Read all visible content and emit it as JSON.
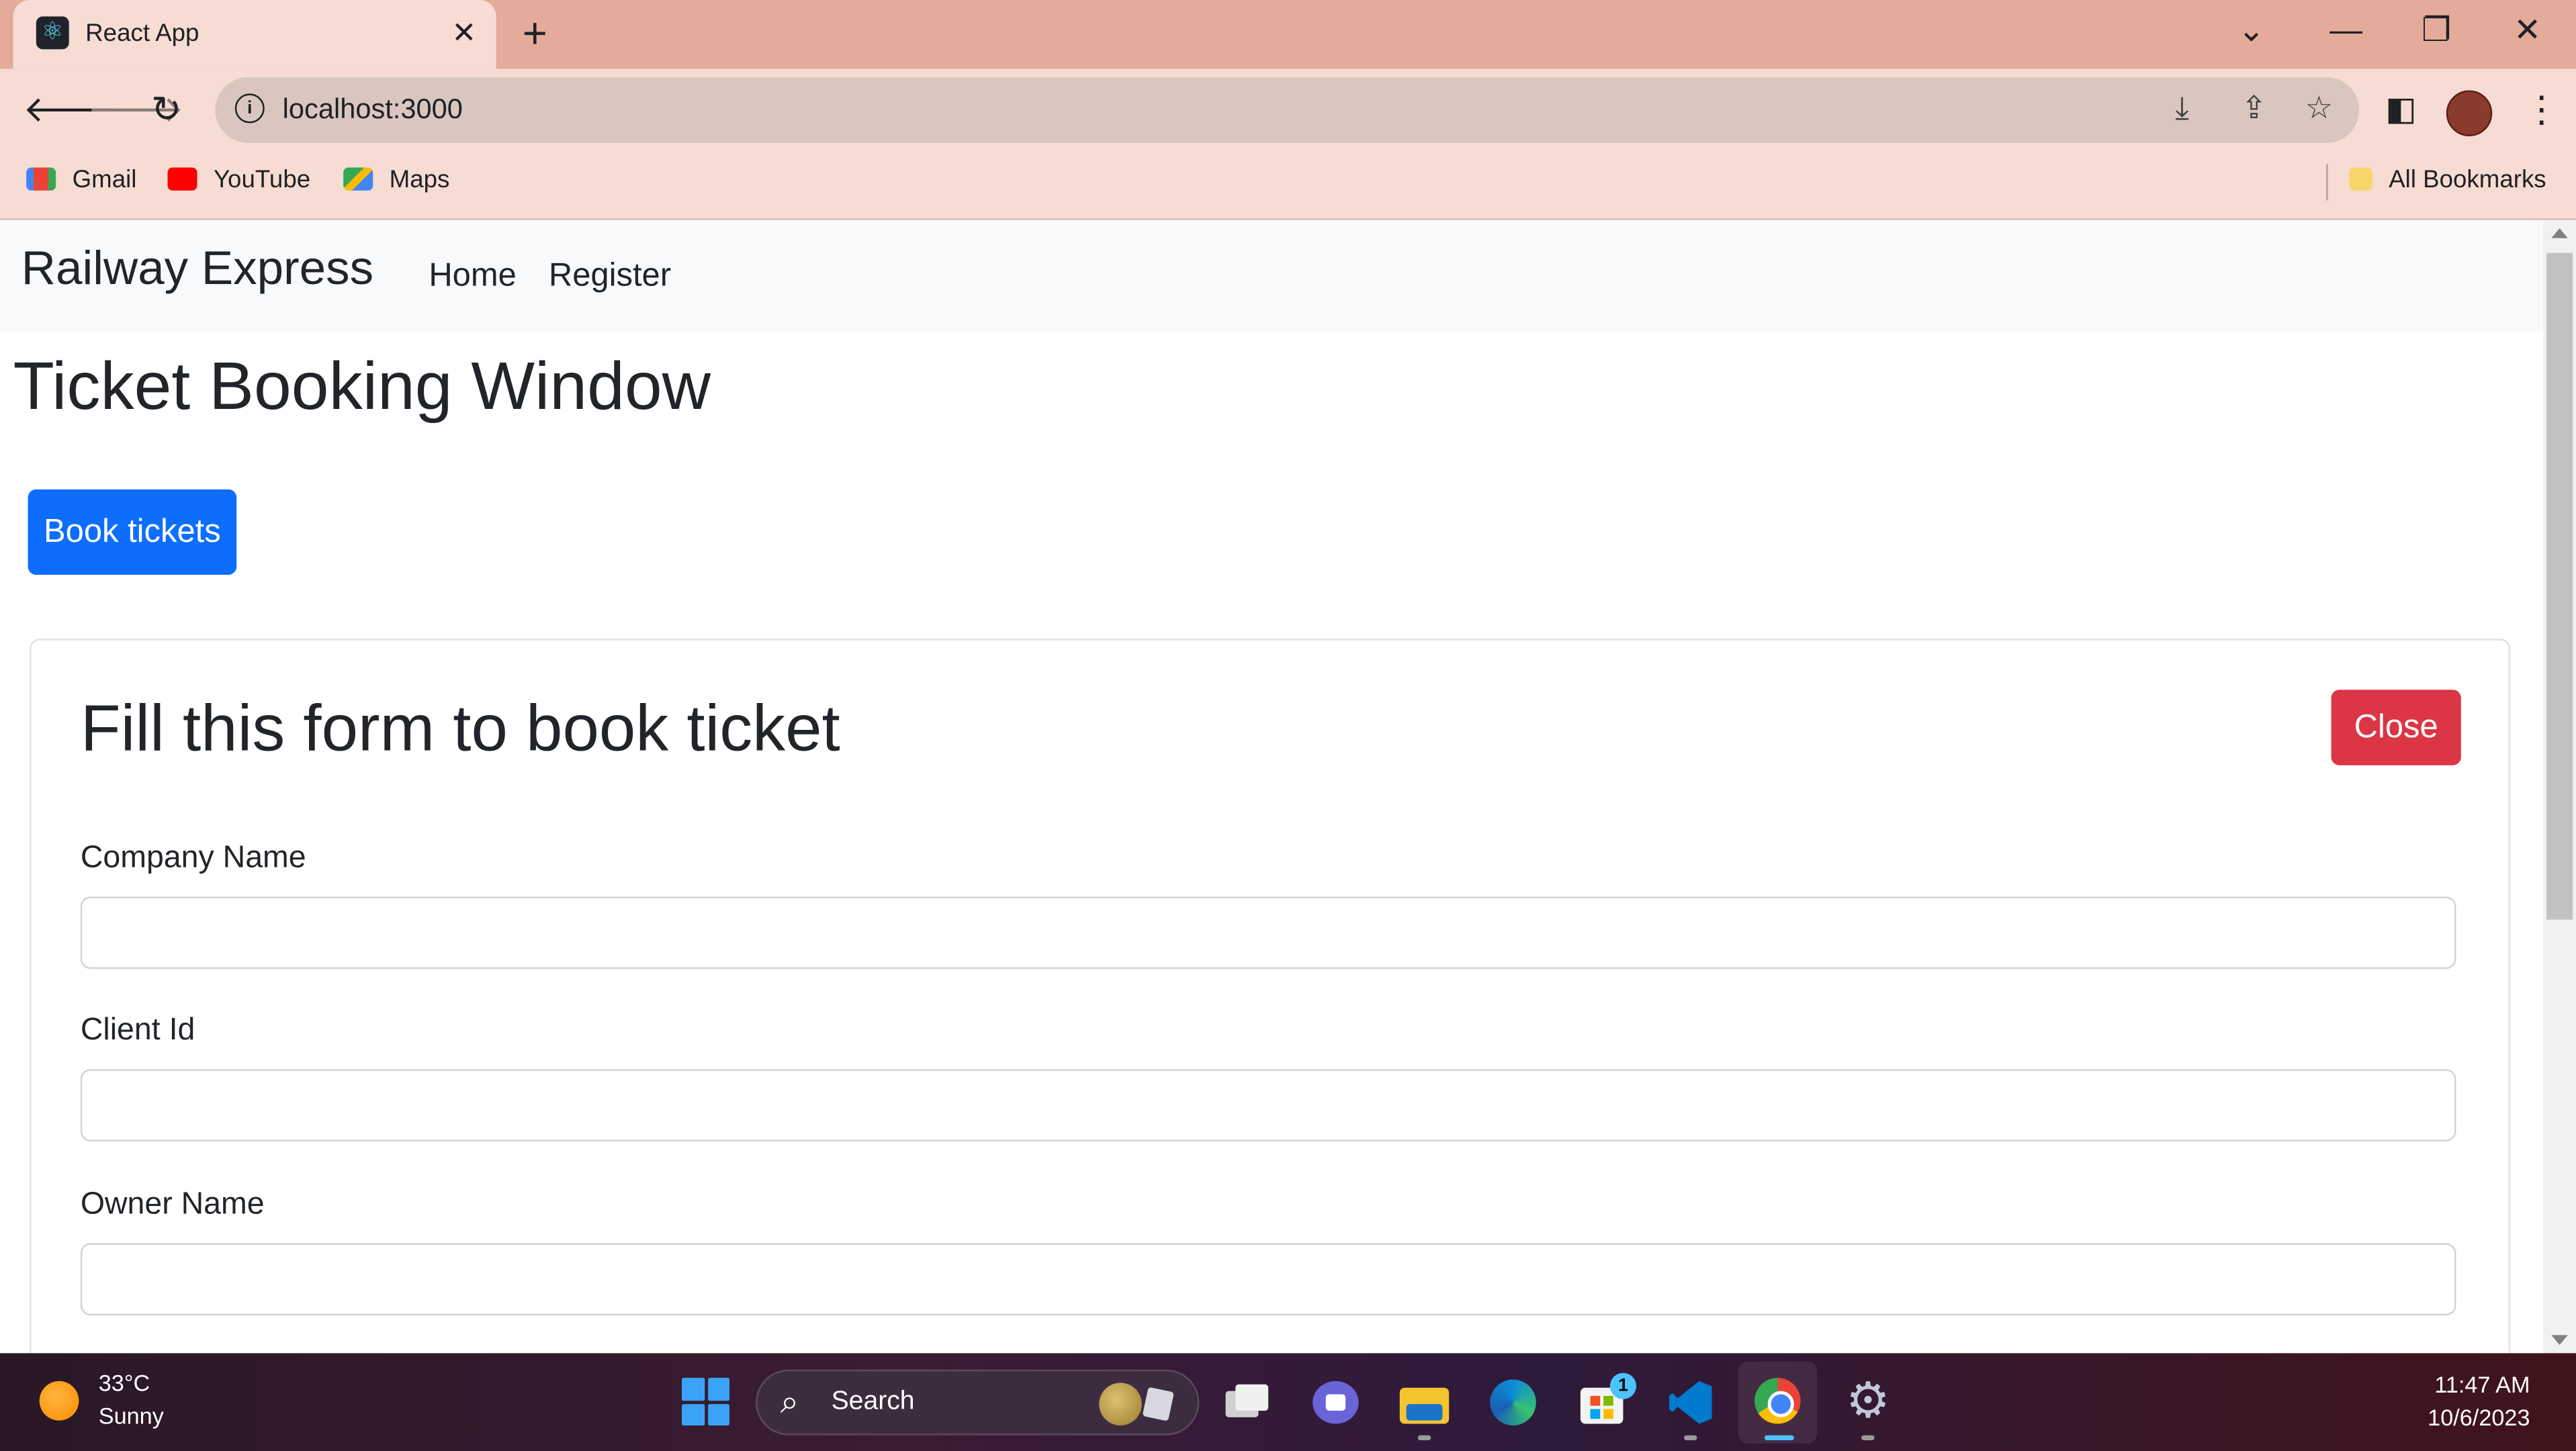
{
  "browser": {
    "tab_title": "React App",
    "tab_close": "✕",
    "new_tab": "+",
    "url": "localhost:3000",
    "window_controls": {
      "tab_search": "⌄",
      "minimize": "—",
      "restore": "❐",
      "close": "✕"
    },
    "bookmarks": [
      {
        "label": "Gmail",
        "icon": "gmail-icon"
      },
      {
        "label": "YouTube",
        "icon": "youtube-icon"
      },
      {
        "label": "Maps",
        "icon": "maps-icon"
      }
    ],
    "all_bookmarks": "All Bookmarks"
  },
  "navbar": {
    "brand": "Railway Express",
    "links": [
      "Home",
      "Register"
    ]
  },
  "main": {
    "title": "Ticket Booking Window",
    "book_button": "Book tickets"
  },
  "form": {
    "title": "Fill this form to book ticket",
    "close_button": "Close",
    "fields": [
      {
        "label": "Company Name",
        "value": ""
      },
      {
        "label": "Client Id",
        "value": ""
      },
      {
        "label": "Owner Name",
        "value": ""
      }
    ]
  },
  "taskbar": {
    "weather": {
      "temp": "33°C",
      "desc": "Sunny"
    },
    "search_placeholder": "Search",
    "store_badge": "1",
    "time": "11:47 AM",
    "date": "10/6/2023"
  },
  "colors": {
    "primary": "#0d6efd",
    "danger": "#dc3545",
    "navbar_bg": "#f8f9fa",
    "chrome_tab_strip": "#e4ab9a",
    "chrome_toolbar": "#f6dcd3"
  }
}
